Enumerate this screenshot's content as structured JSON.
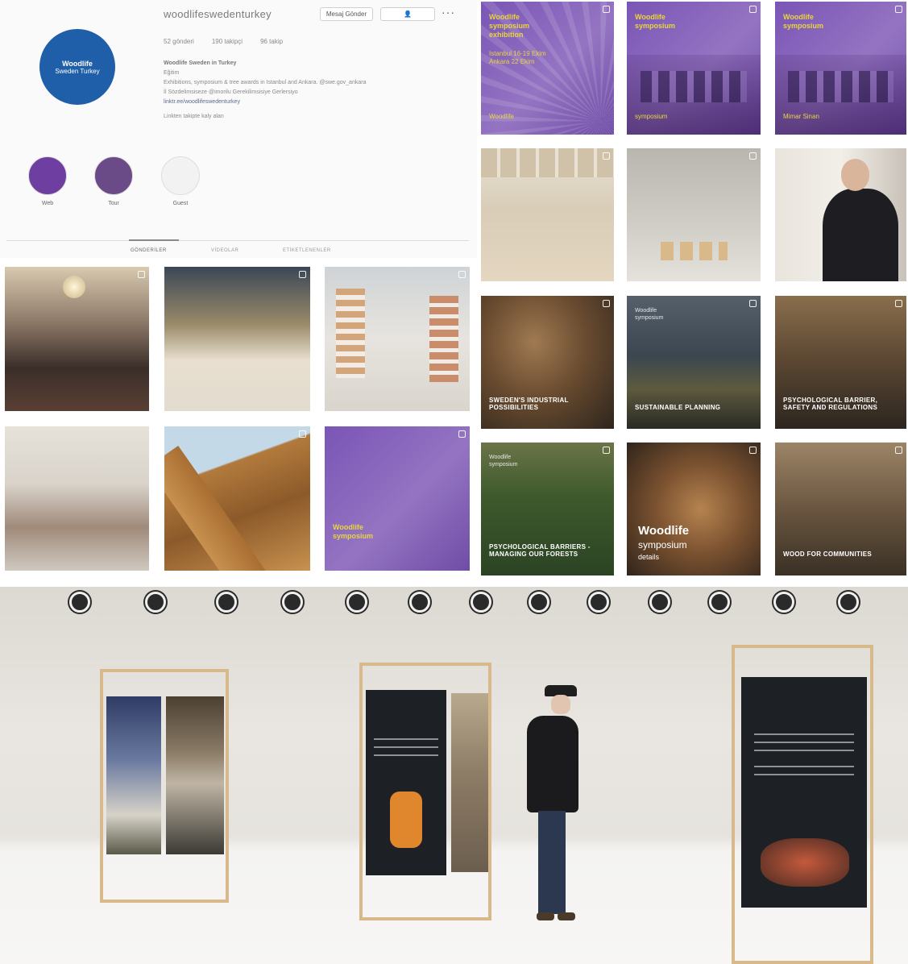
{
  "profile": {
    "username": "woodlifeswedenturkey",
    "avatar_line1": "Woodlife",
    "avatar_line2": "Sweden Turkey",
    "message_button": "Mesaj Gönder",
    "follow_button": "Takip",
    "more": "···",
    "posts": "52 gönderi",
    "followers": "190 takipçi",
    "following": "96 takip",
    "bio_name": "Woodlife Sweden in Turkey",
    "bio_category": "Eğitim",
    "bio_line1": "Exhibitions, symposium & tree awards in Istanbul and Ankara. @swe.gov_ankara",
    "bio_line2": "İl Sözdelimsiseze @imorilu Gerekilimsisiye Gerlersiyo",
    "bio_link": "linktr.ee/woodlifeswedenturkey",
    "bio_followed_by": "Linkten takipte kaly alan",
    "highlights": [
      "Web",
      "Tour",
      "Guest"
    ],
    "tabs": [
      "GÖNDERİLER",
      "VİDEOLAR",
      "ETİKETLENENLER"
    ]
  },
  "tiles": {
    "purple_head_a": "Woodlife",
    "purple_head_b": "symposium",
    "purple_head_c": "exhibition",
    "purple_dates": "Istanbul 16-19 Ekim",
    "purple_dates2": "Ankara 22 Ekim",
    "purple_foot": "Woodlife",
    "purple_foot2": "symposium",
    "purple_foot3": "Mimar Sinan",
    "cap_wood": "SWEDEN'S INDUSTRIAL POSSIBILITIES",
    "cap_mount": "SUSTAINABLE PLANNING",
    "cap_truss": "PSYCHOLOGICAL BARRIER, SAFETY AND REGULATIONS",
    "cap_forest": "PSYCHOLOGICAL BARRIERS - MANAGING OUR FORESTS",
    "cap_carve_a": "Woodlife",
    "cap_carve_b": "symposium",
    "cap_carve_c": "details",
    "cap_hall": "WOOD FOR COMMUNITIES",
    "dark_top_a": "Woodlife",
    "dark_top_b": "symposium"
  },
  "colors": {
    "brand_blue": "#1f5ea8",
    "purple": "#7a55b6",
    "yellow_text": "#e9d63a",
    "wood": "#d8b98c"
  }
}
